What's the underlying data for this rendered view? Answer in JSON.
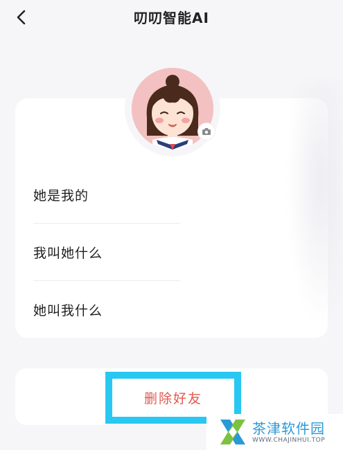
{
  "header": {
    "title": "叨叨智能AI",
    "back_icon": "chevron-left-icon"
  },
  "avatar": {
    "description_icon": "avatar-girl-illustration",
    "camera_icon": "camera-icon"
  },
  "relations": {
    "items": [
      {
        "label": "她是我的"
      },
      {
        "label": "我叫她什么"
      },
      {
        "label": "她叫我什么"
      }
    ]
  },
  "actions": {
    "delete_label": "删除好友",
    "highlight_color": "#28c8f2",
    "delete_color": "#e2574c"
  },
  "watermark": {
    "cn": "茶津软件园",
    "en": "WWW.CHAJINHUI.TOP",
    "logo_icon": "watermark-x-logo"
  }
}
